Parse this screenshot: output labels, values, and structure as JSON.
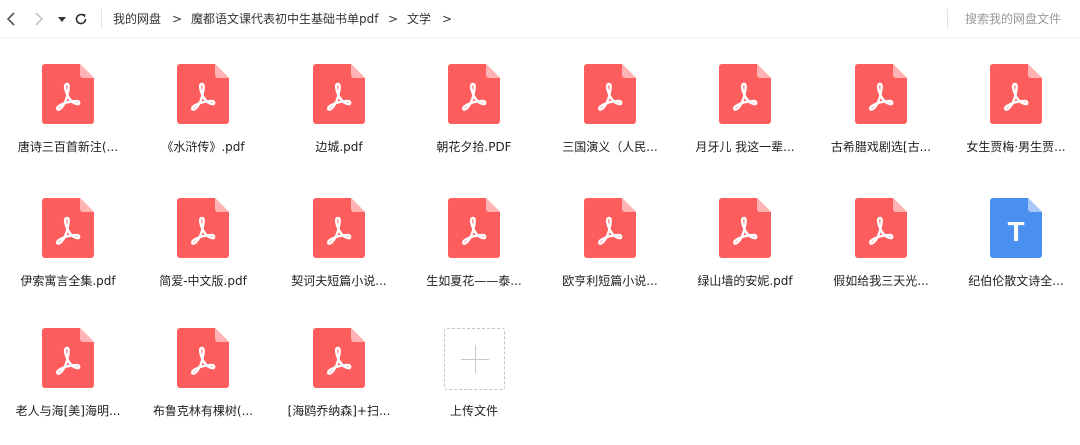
{
  "toolbar": {
    "breadcrumb": [
      "我的网盘",
      "魔都语文课代表初中生基础书单pdf",
      "文学"
    ],
    "breadcrumb_separator": ">",
    "search_placeholder": "搜索我的网盘文件"
  },
  "colors": {
    "pdf_red": "#fe5d5d",
    "pdf_fold": "#ffb3b3",
    "doc_blue": "#4a90f0",
    "doc_fold": "#a9c8f8"
  },
  "files": [
    {
      "name": "唐诗三百首新注(...",
      "icon": "pdf-icon"
    },
    {
      "name": "《水浒传》.pdf",
      "icon": "pdf-icon"
    },
    {
      "name": "边城.pdf",
      "icon": "pdf-icon"
    },
    {
      "name": "朝花夕拾.PDF",
      "icon": "pdf-icon"
    },
    {
      "name": "三国演义（人民...",
      "icon": "pdf-icon"
    },
    {
      "name": "月牙儿 我这一辈...",
      "icon": "pdf-icon"
    },
    {
      "name": "古希腊戏剧选[古...",
      "icon": "pdf-icon"
    },
    {
      "name": "女生贾梅·男生贾...",
      "icon": "pdf-icon"
    },
    {
      "name": "伊索寓言全集.pdf",
      "icon": "pdf-icon"
    },
    {
      "name": "简爱-中文版.pdf",
      "icon": "pdf-icon"
    },
    {
      "name": "契诃夫短篇小说...",
      "icon": "pdf-icon"
    },
    {
      "name": "生如夏花——泰...",
      "icon": "pdf-icon"
    },
    {
      "name": "欧亨利短篇小说...",
      "icon": "pdf-icon"
    },
    {
      "name": "绿山墙的安妮.pdf",
      "icon": "pdf-icon"
    },
    {
      "name": "假如给我三天光...",
      "icon": "pdf-icon"
    },
    {
      "name": "纪伯伦散文诗全...",
      "icon": "text-doc-icon",
      "glyph": "T"
    },
    {
      "name": "老人与海[美]海明...",
      "icon": "pdf-icon"
    },
    {
      "name": "布鲁克林有棵树(...",
      "icon": "pdf-icon"
    },
    {
      "name": "[海鸥乔纳森]+扫...",
      "icon": "pdf-icon"
    }
  ],
  "upload": {
    "label": "上传文件"
  }
}
